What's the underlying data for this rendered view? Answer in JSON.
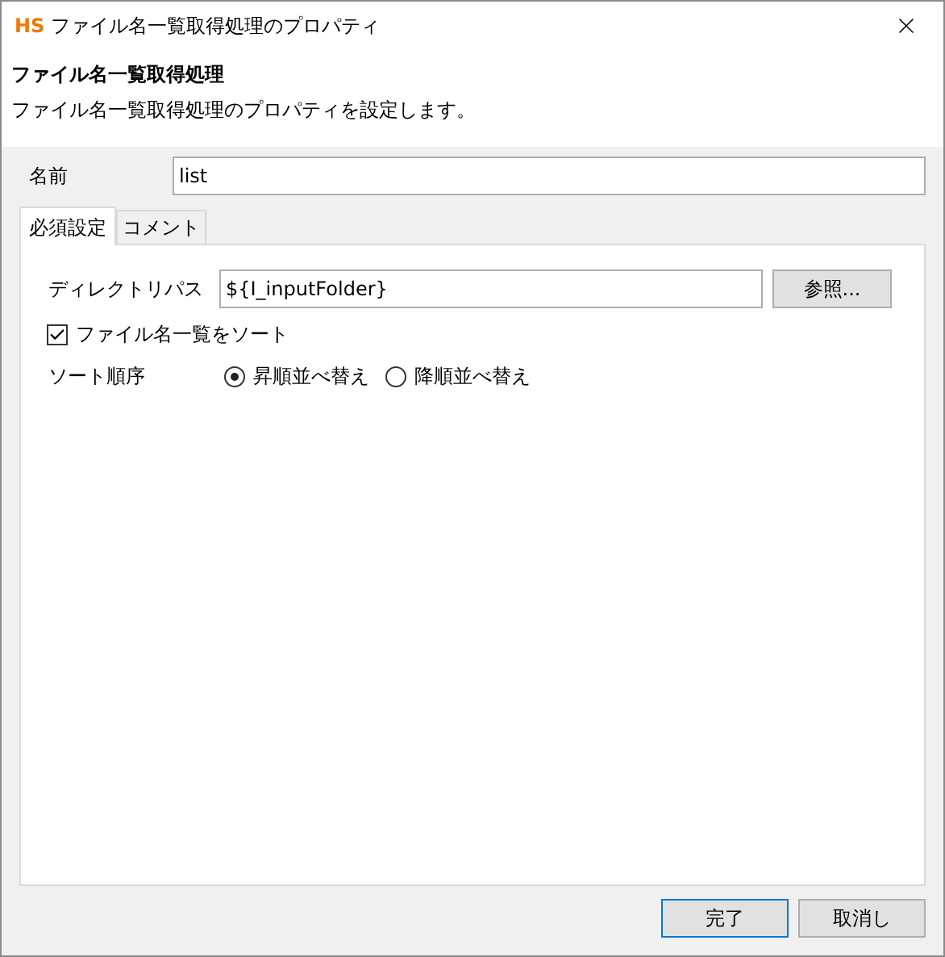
{
  "window": {
    "logo": "HS",
    "title": "ファイル名一覧取得処理のプロパティ"
  },
  "header": {
    "title": "ファイル名一覧取得処理",
    "description": "ファイル名一覧取得処理のプロパティを設定します。"
  },
  "name_field": {
    "label": "名前",
    "value": "list"
  },
  "tabs": [
    {
      "label": "必須設定",
      "selected": true
    },
    {
      "label": "コメント",
      "selected": false
    }
  ],
  "directory": {
    "label": "ディレクトリパス",
    "value": "${I_inputFolder}",
    "button": "参照..."
  },
  "sort_checkbox": {
    "label": "ファイル名一覧をソート",
    "checked": true
  },
  "sort_order": {
    "label": "ソート順序",
    "options": [
      {
        "label": "昇順並べ替え",
        "selected": true
      },
      {
        "label": "降順並べ替え",
        "selected": false
      }
    ]
  },
  "buttons": [
    {
      "label": "完了",
      "default": true
    },
    {
      "label": "取消し",
      "default": false
    }
  ]
}
